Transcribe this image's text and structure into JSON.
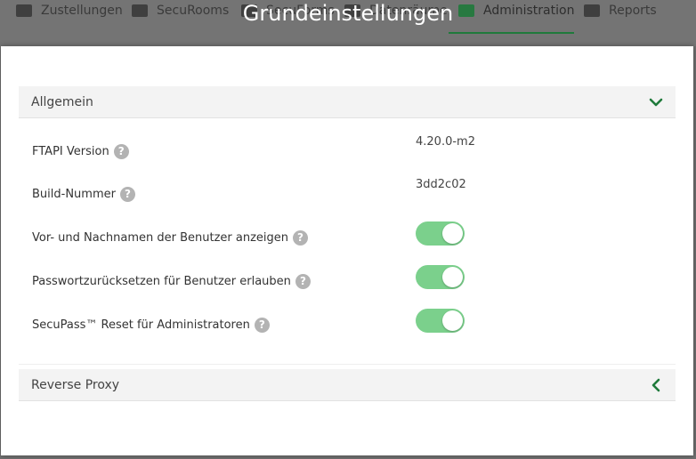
{
  "nav": {
    "items": [
      {
        "label": "Zustellungen",
        "icon": "mail-icon"
      },
      {
        "label": "SecuRooms",
        "icon": "inbox-icon"
      },
      {
        "label": "SecuForms",
        "icon": "form-icon"
      },
      {
        "label": "Datenräume",
        "icon": "folder-icon"
      },
      {
        "label": "Administration",
        "icon": "toolbox-icon",
        "active": true
      },
      {
        "label": "Reports",
        "icon": "list-icon"
      }
    ]
  },
  "modal": {
    "title": "Grundeinstellungen"
  },
  "sections": {
    "general": {
      "title": "Allgemein",
      "expanded": true,
      "rows": {
        "version": {
          "label": "FTAPI Version",
          "value": "4.20.0-m2"
        },
        "build": {
          "label": "Build-Nummer",
          "value": "3dd2c02"
        },
        "show_names": {
          "label": "Vor- und Nachnamen der Benutzer anzeigen",
          "enabled": true
        },
        "password_reset": {
          "label": "Passwortzurücksetzen für Benutzer erlauben",
          "enabled": true
        },
        "secupass_reset": {
          "label": "SecuPass™ Reset für Administratoren",
          "enabled": true
        }
      }
    },
    "reverse_proxy": {
      "title": "Reverse Proxy",
      "expanded": false
    }
  },
  "colors": {
    "accent": "#1f7a3b",
    "toggle_on": "#7bd08c",
    "overlay": "#6f6f6f"
  }
}
